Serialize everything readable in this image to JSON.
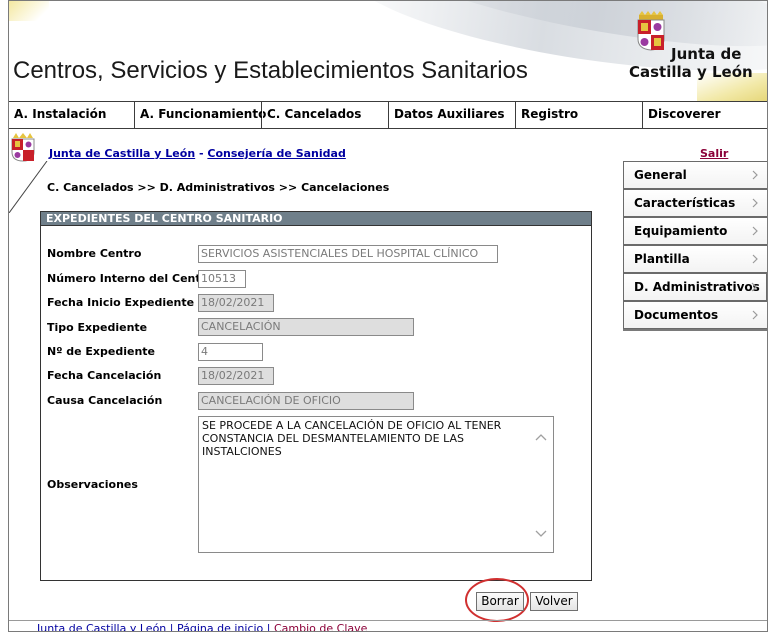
{
  "header": {
    "site_title": "Centros, Servicios y Establecimientos Sanitarios",
    "logo_line1": "Junta de",
    "logo_line2": "Castilla y León"
  },
  "menu": [
    {
      "label": "A. Instalación"
    },
    {
      "label": "A. Funcionamiento"
    },
    {
      "label": "C. Cancelados"
    },
    {
      "label": "Datos Auxiliares"
    },
    {
      "label": "Registro"
    },
    {
      "label": "Discoverer"
    }
  ],
  "linkbar": {
    "link1": "Junta de Castilla y León",
    "sep": " - ",
    "link2": "Consejería de Sanidad",
    "salir": "Salir"
  },
  "breadcrumb": "C. Cancelados >> D. Administrativos >> Cancelaciones",
  "sidenav": [
    {
      "label": "General"
    },
    {
      "label": "Características"
    },
    {
      "label": "Equipamiento"
    },
    {
      "label": "Plantilla"
    },
    {
      "label": "D. Administrativos"
    },
    {
      "label": "Documentos"
    }
  ],
  "panel": {
    "title": "EXPEDIENTES DEL CENTRO SANITARIO",
    "fields": [
      {
        "label": "Nombre Centro",
        "value": "SERVICIOS ASISTENCIALES DEL HOSPITAL CLÍNICO"
      },
      {
        "label": "Número Interno del Centro",
        "value": "10513"
      },
      {
        "label": "Fecha Inicio Expediente",
        "value": "18/02/2021"
      },
      {
        "label": "Tipo Expediente",
        "value": "CANCELACIÓN"
      },
      {
        "label": "Nº de Expediente",
        "value": "4"
      },
      {
        "label": "Fecha Cancelación",
        "value": "18/02/2021"
      },
      {
        "label": "Causa Cancelación",
        "value": "CANCELACIÓN DE OFICIO"
      }
    ],
    "observaciones_label": "Observaciones",
    "observaciones_value": "SE PROCEDE A LA CANCELACIÓN DE OFICIO AL TENER CONSTANCIA DEL DESMANTELAMIENTO DE LAS INSTALCIONES"
  },
  "buttons": {
    "borrar": "Borrar",
    "volver": "Volver"
  },
  "footer": {
    "link1": "Junta de Castilla y León",
    "sep": " | ",
    "link2": "Página de inicio",
    "link3": "Cambio de Clave"
  },
  "colors": {
    "panel_header": "#6f7f8a",
    "link": "#0000a0",
    "salir": "#8b0038",
    "highlight": "#d03030"
  }
}
